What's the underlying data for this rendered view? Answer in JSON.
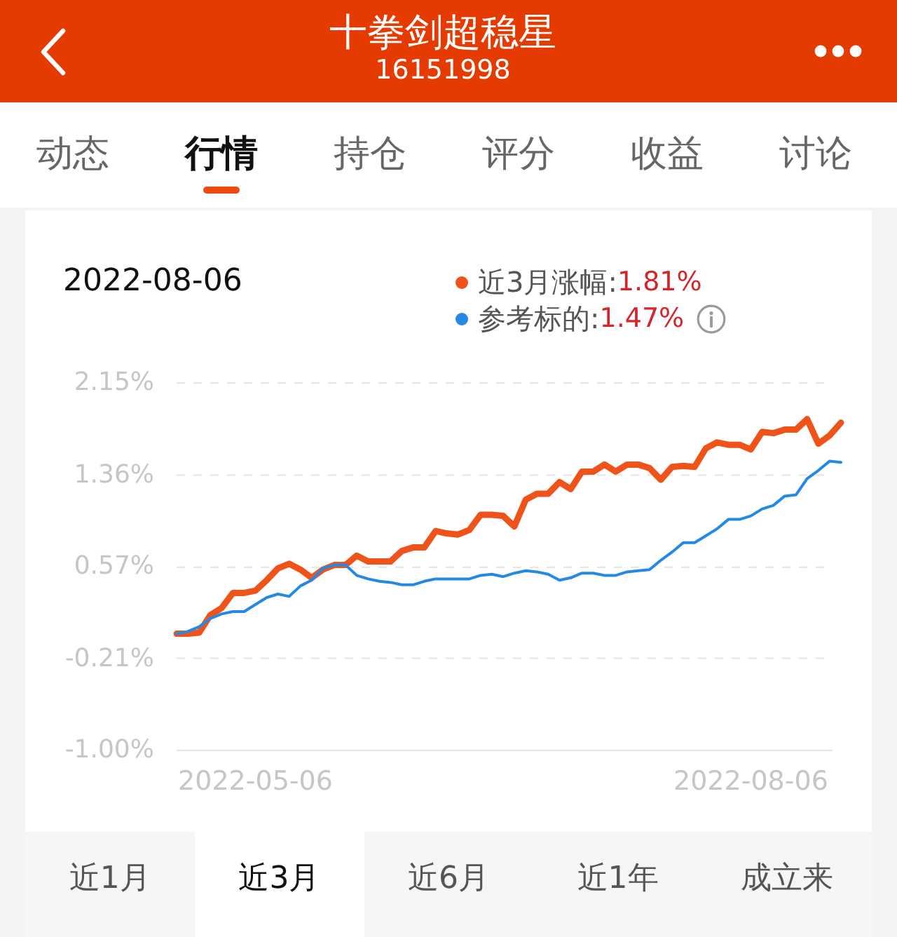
{
  "header": {
    "title": "十拳剑超稳星",
    "code": "16151998"
  },
  "tabs": [
    {
      "label": "动态",
      "selected": false
    },
    {
      "label": "行情",
      "selected": true
    },
    {
      "label": "持仓",
      "selected": false
    },
    {
      "label": "评分",
      "selected": false
    },
    {
      "label": "收益",
      "selected": false
    },
    {
      "label": "讨论",
      "selected": false
    }
  ],
  "chart_panel": {
    "date": "2022-08-06",
    "legend": [
      {
        "label": "近3月涨幅:",
        "value": "1.81%",
        "color": "#f0531a",
        "info": false
      },
      {
        "label": "参考标的:",
        "value": "1.47%",
        "color": "#2389e3",
        "info": true
      }
    ],
    "chart_data": {
      "type": "line",
      "grid": true,
      "categories": [
        null,
        null,
        null,
        null,
        null,
        null,
        null,
        "2022-05-06",
        null,
        null,
        null,
        null,
        null,
        null,
        null,
        null,
        null,
        null,
        null,
        null,
        null,
        null,
        null,
        null,
        null,
        null,
        null,
        null,
        null,
        null,
        null,
        null,
        null,
        null,
        null,
        null,
        null,
        null,
        null,
        null,
        null,
        null,
        null,
        null,
        null,
        null,
        null,
        null,
        null,
        null,
        null,
        "2022-08-06",
        null,
        null,
        null,
        null,
        null,
        null,
        null,
        null
      ],
      "ylim": [
        -1.0,
        2.15
      ],
      "yticks": [
        {
          "value": 2.15,
          "label": "2.15%"
        },
        {
          "value": 1.36,
          "label": "1.36%"
        },
        {
          "value": 0.57,
          "label": "0.57%"
        },
        {
          "value": -0.21,
          "label": "-0.21%"
        },
        {
          "value": -1.0,
          "label": "-1.00%"
        }
      ],
      "series": [
        {
          "color": "#f0531a",
          "values": [
            0.0,
            0.0,
            0.01,
            0.16,
            0.22,
            0.35,
            0.35,
            0.37,
            0.46,
            0.56,
            0.6,
            0.55,
            0.48,
            0.55,
            0.59,
            0.59,
            0.67,
            0.62,
            0.62,
            0.62,
            0.71,
            0.74,
            0.74,
            0.88,
            0.86,
            0.85,
            0.89,
            1.02,
            1.02,
            1.01,
            0.92,
            1.15,
            1.2,
            1.2,
            1.3,
            1.24,
            1.39,
            1.39,
            1.45,
            1.39,
            1.45,
            1.45,
            1.42,
            1.32,
            1.43,
            1.44,
            1.43,
            1.59,
            1.64,
            1.62,
            1.62,
            1.58,
            1.73,
            1.72,
            1.75,
            1.75,
            1.84,
            1.63,
            1.7,
            1.81
          ]
        },
        {
          "color": "#2389e3",
          "values": [
            0.0,
            0.02,
            0.06,
            0.13,
            0.17,
            0.19,
            0.19,
            0.25,
            0.31,
            0.34,
            0.32,
            0.41,
            0.46,
            0.56,
            0.59,
            0.59,
            0.5,
            0.47,
            0.45,
            0.44,
            0.42,
            0.42,
            0.45,
            0.47,
            0.47,
            0.47,
            0.47,
            0.5,
            0.51,
            0.49,
            0.52,
            0.54,
            0.53,
            0.51,
            0.46,
            0.48,
            0.52,
            0.52,
            0.5,
            0.5,
            0.53,
            0.54,
            0.55,
            0.63,
            0.7,
            0.78,
            0.78,
            0.84,
            0.9,
            0.98,
            0.98,
            1.01,
            1.07,
            1.1,
            1.18,
            1.19,
            1.33,
            1.4,
            1.48,
            1.47
          ]
        }
      ]
    }
  },
  "periods": [
    {
      "label": "近1月",
      "selected": false
    },
    {
      "label": "近3月",
      "selected": true
    },
    {
      "label": "近6月",
      "selected": false
    },
    {
      "label": "近1年",
      "selected": false
    },
    {
      "label": "成立来",
      "selected": false
    }
  ]
}
